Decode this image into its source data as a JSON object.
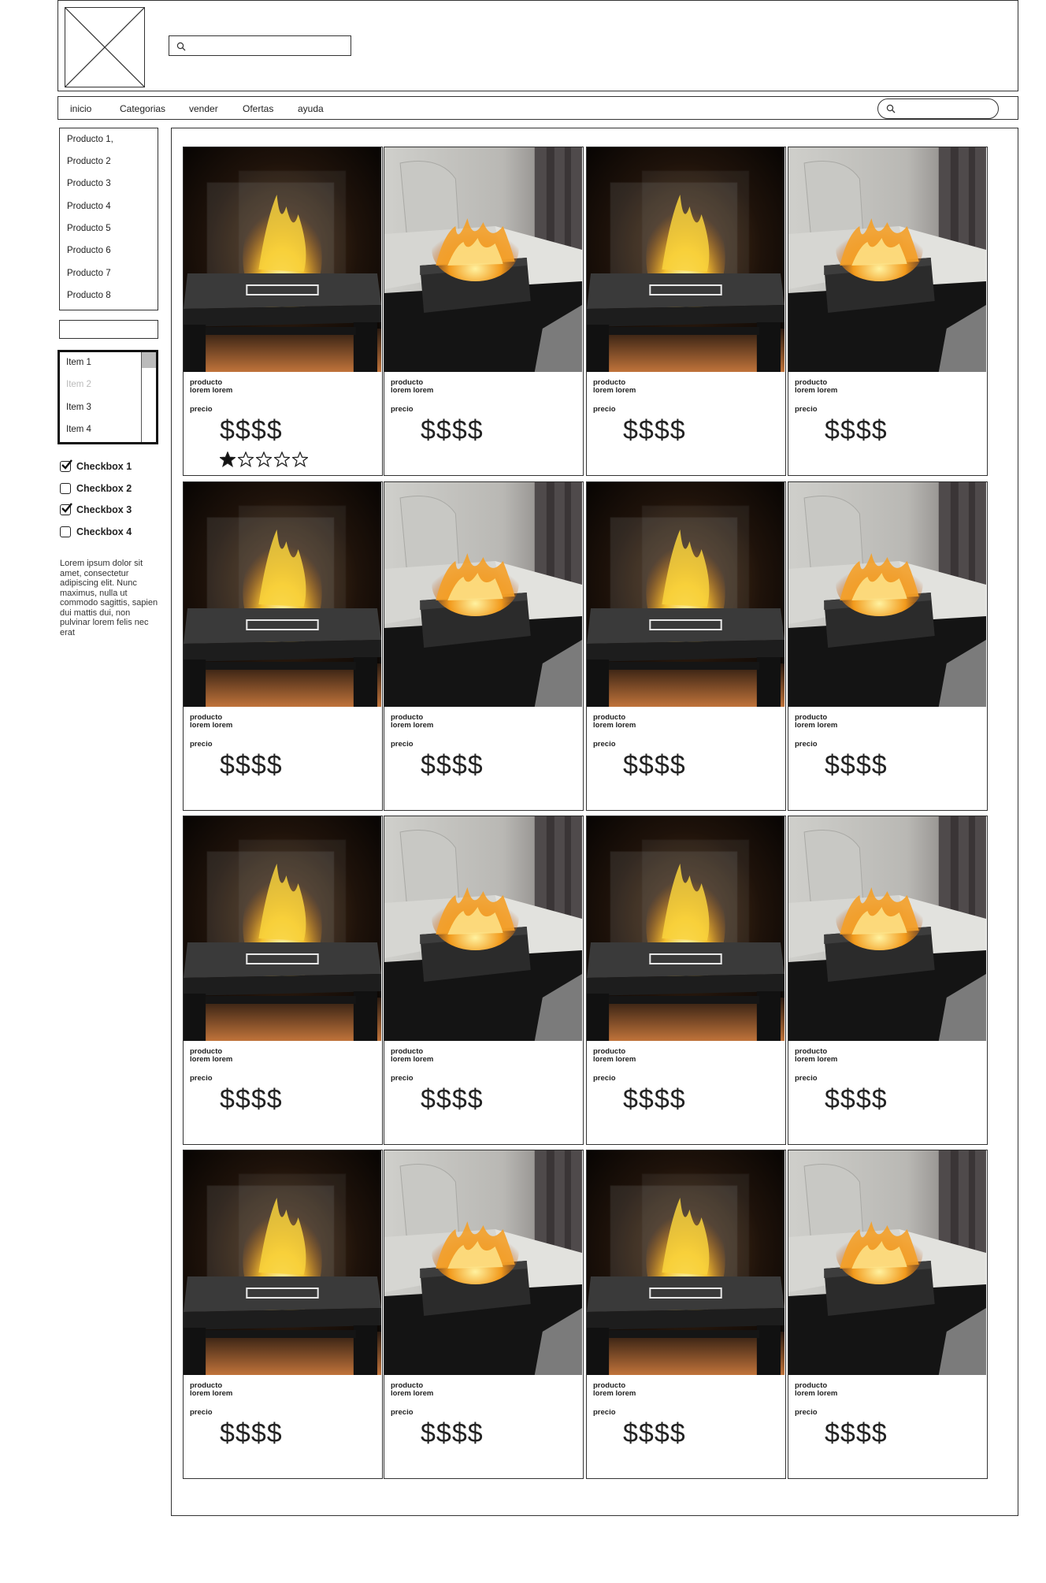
{
  "header": {
    "search_placeholder": ""
  },
  "nav": {
    "items": [
      "inicio",
      "Categorias",
      "vender",
      "Ofertas",
      "ayuda"
    ],
    "search_placeholder": ""
  },
  "sidebar": {
    "products": [
      "Producto 1,",
      "Producto 2",
      "Producto 3",
      "Producto 4",
      "Producto 5",
      "Producto 6",
      "Producto 7",
      "Producto 8"
    ],
    "input_value": "",
    "listbox": [
      {
        "label": "Item 1",
        "disabled": false
      },
      {
        "label": "Item 2",
        "disabled": true
      },
      {
        "label": "Item 3",
        "disabled": false
      },
      {
        "label": "Item 4",
        "disabled": false
      }
    ],
    "checkboxes": [
      {
        "label": "Checkbox 1",
        "checked": true
      },
      {
        "label": "Checkbox 2",
        "checked": false
      },
      {
        "label": "Checkbox 3",
        "checked": true
      },
      {
        "label": "Checkbox 4",
        "checked": false
      }
    ],
    "lorem": "Lorem ipsum dolor sit amet, consectetur adipiscing elit. Nunc maximus, nulla ut commodo sagittis, sapien dui mattis dui, non pulvinar lorem felis nec erat"
  },
  "products": {
    "name_line1": "producto",
    "name_line2": "lorem lorem",
    "price_label": "precio",
    "price": "$$$$",
    "first_card_rating": 1,
    "rating_max": 5,
    "image_pattern": [
      "glass-fireplace",
      "tray-fireplace",
      "glass-fireplace",
      "tray-fireplace"
    ]
  }
}
